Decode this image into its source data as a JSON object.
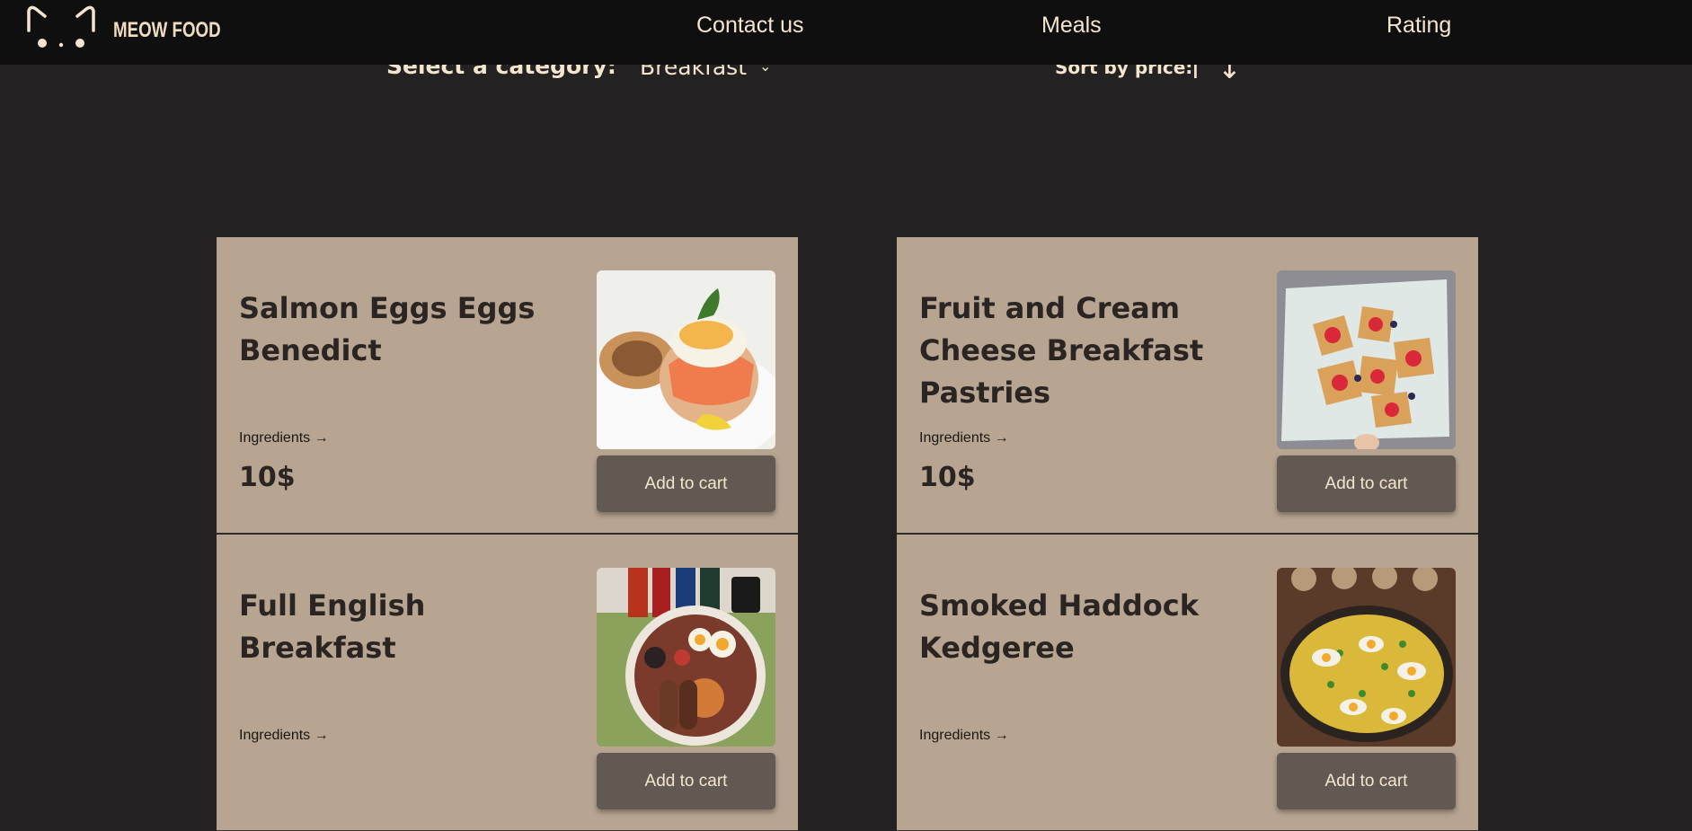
{
  "header": {
    "brand": "MEOW FOOD",
    "logo_icon": "cat-face-logo",
    "nav": [
      {
        "label": "Contact us"
      },
      {
        "label": "Meals"
      },
      {
        "label": "Rating"
      }
    ]
  },
  "filters": {
    "category_label": "Select a category:",
    "category_value": "Breakfast",
    "sort_label": "Sort by price:",
    "sort_up": "↑",
    "sort_down": "↓"
  },
  "meals": [
    {
      "title": "Salmon Eggs Eggs Benedict",
      "ingredients": "Ingredients →",
      "price": "10$",
      "cart": "Add to cart",
      "image": "salmon-eggs-benedict-photo"
    },
    {
      "title": "Fruit and Cream Cheese Breakfast Pastries",
      "ingredients": "Ingredients →",
      "price": "10$",
      "cart": "Add to cart",
      "image": "fruit-pastries-photo"
    },
    {
      "title": "Full English Breakfast",
      "ingredients": "Ingredients →",
      "price": "",
      "cart": "Add to cart",
      "image": "full-english-breakfast-photo"
    },
    {
      "title": "Smoked Haddock Kedgeree",
      "ingredients": "Ingredients →",
      "price": "",
      "cart": "Add to cart",
      "image": "kedgeree-photo"
    }
  ],
  "colors": {
    "background": "#232122",
    "topbar": "#0f0f0f",
    "card": "#b7a592",
    "button": "#625a52",
    "accent_text": "#f4e5cf"
  }
}
